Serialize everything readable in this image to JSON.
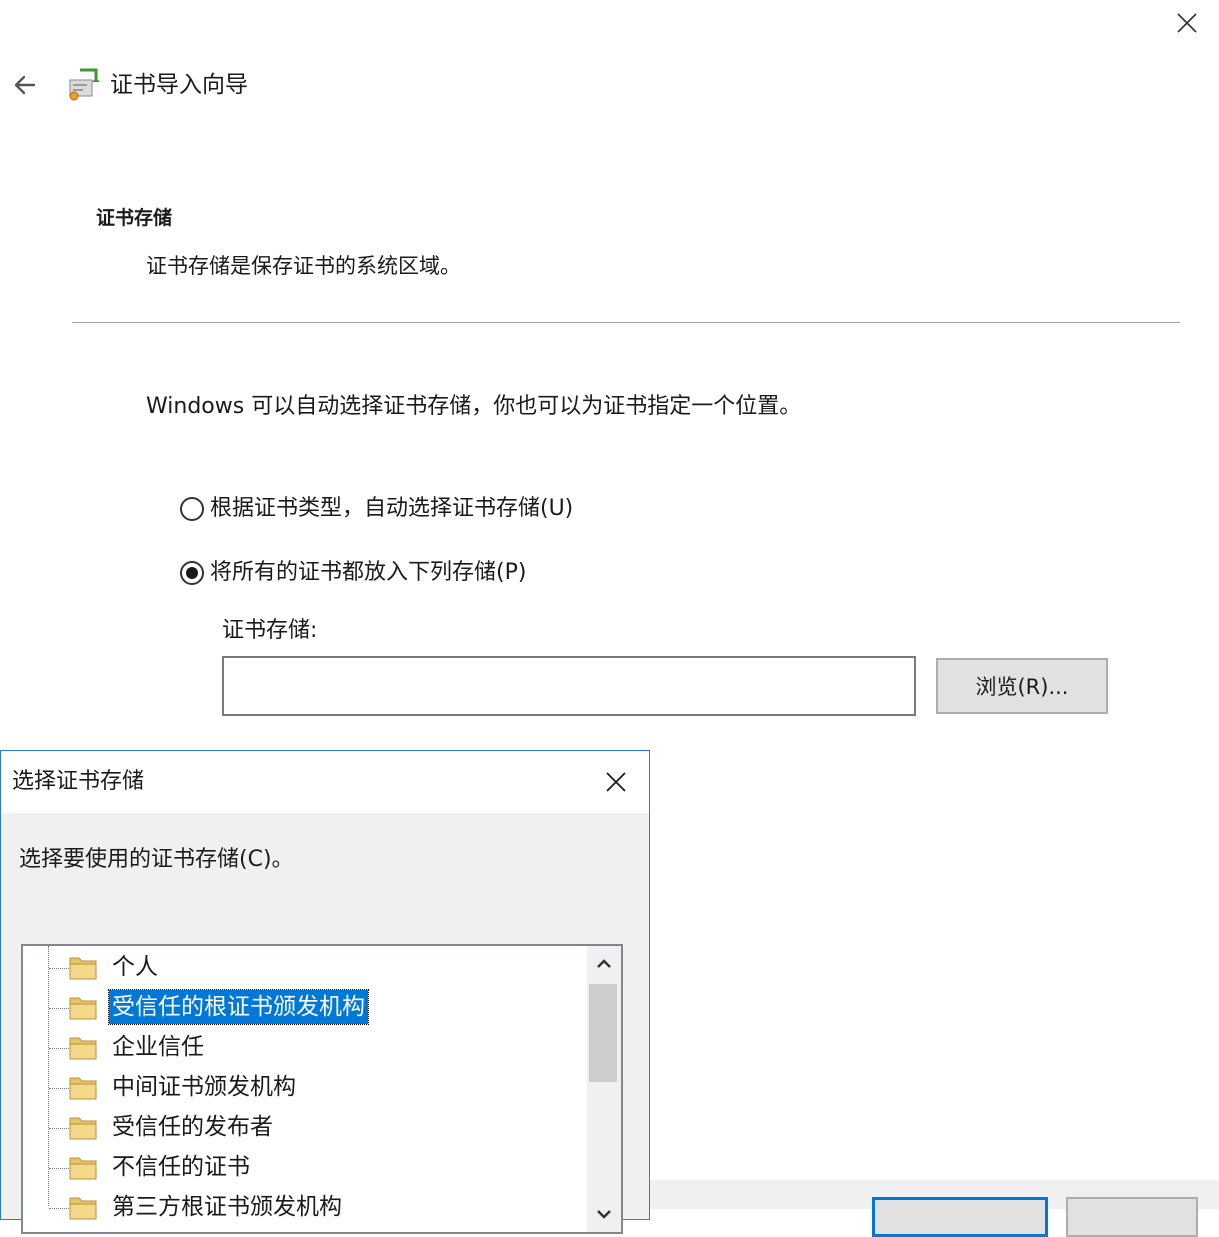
{
  "wizard": {
    "title": "证书导入向导",
    "section_title": "证书存储",
    "section_desc": "证书存储是保存证书的系统区域。",
    "intro": "Windows 可以自动选择证书存储，你也可以为证书指定一个位置。",
    "radio_auto": {
      "label": "根据证书类型，自动选择证书存储(U)",
      "checked": false
    },
    "radio_manual": {
      "label": "将所有的证书都放入下列存储(P)",
      "checked": true
    },
    "store_label": "证书存储:",
    "store_value": "",
    "browse_label": "浏览(R)..."
  },
  "dialog": {
    "title": "选择证书存储",
    "prompt": "选择要使用的证书存储(C)。",
    "tree_items": [
      {
        "label": "个人",
        "selected": false
      },
      {
        "label": "受信任的根证书颁发机构",
        "selected": true
      },
      {
        "label": "企业信任",
        "selected": false
      },
      {
        "label": "中间证书颁发机构",
        "selected": false
      },
      {
        "label": "受信任的发布者",
        "selected": false
      },
      {
        "label": "不信任的证书",
        "selected": false
      },
      {
        "label": "第三方根证书颁发机构",
        "selected": false
      }
    ]
  },
  "colors": {
    "accent": "#0078d7",
    "selection": "#0078d7",
    "folder": "#f5d78a"
  }
}
